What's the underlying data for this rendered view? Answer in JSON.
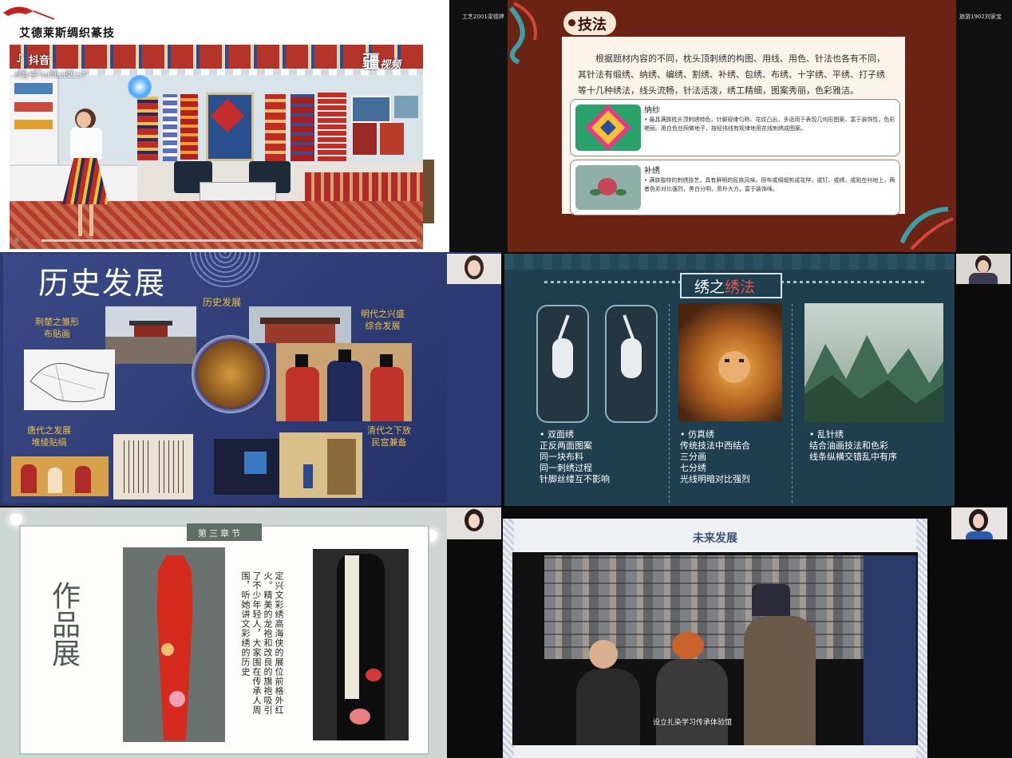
{
  "tile1": {
    "brand": "艾德莱斯绸织篆技",
    "tiktok_name": "抖音",
    "tiktok_id": "抖音号: 4058282257",
    "video_brand": "疆",
    "video_brand2": "视频",
    "participant_name": "工艺2001梁德婷"
  },
  "tile2": {
    "title": "技法",
    "intro": "根据题材内容的不同，枕头顶刺绣的构图、用线、用色、针法也各有不同，其针法有缎绣、纳绣、编绣、割绣、补绣、包绣、布绣、十字绣、平绣、打子绣等十几种绣法，线头流畅，针法活泼，绣工精细，图案秀丽，色彩雅洁。",
    "card1_title": "纳纱",
    "card1_text": "最具满族枕头顶刺绣特色，针脚规律匀称、花纹凸出，多适用于表现几何形图案，富于装饰性，色彩艳丽。用白色丝网做地子，按经纬线有规律地用花线刺绣成图案。",
    "card2_title": "补绣",
    "card2_text": "满族独特的刺绣技艺，具有鲜明的民族风味。用布或绸缎剪成花样，或钉、或绣、或贴在衬地上，两者色彩对比强烈，黑白分明，质朴大方，富于装饰味。",
    "participant_name": "旅游1902刘家宝"
  },
  "tile3": {
    "title": "历史发展",
    "center_label": "历史发展",
    "label_chu": "荆楚之雏形\n布贴画",
    "label_ming": "明代之兴盛\n综合发展",
    "label_tang": "唐代之发展\n堆绫贴绢",
    "label_qing": "清代之下放\n民宫兼备"
  },
  "tile4": {
    "title_a": "绣之",
    "title_b": "绣法",
    "col1": [
      "• 双面绣",
      "正反两面图案",
      "同一块布料",
      "同一刺绣过程",
      "针脚丝缕互不影响"
    ],
    "col2": [
      "• 仿真绣",
      "传统技法中西结合",
      "三分画",
      "七分绣",
      "光线明暗对比强烈"
    ],
    "col3": [
      "• 乱针绣",
      "结合油画技法和色彩",
      "线条纵横交错乱中有序"
    ]
  },
  "tile5": {
    "chapter": "第三章节",
    "title": "作品展",
    "poem": "定兴文彩绣高海侠的展位前格外红火。精美的龙袍和改良的旗袍吸引了不少年轻人，大家围在传承人周围，听她讲文彩绣的历史"
  },
  "tile6": {
    "title": "未来发展",
    "caption": "设立扎染学习传承体验馆"
  },
  "colors": {
    "tile2_bg": "#6b2413",
    "tile3_bg": "#2b3a72",
    "tile4_bg": "#1f3f4f",
    "tile5_bg": "#cdd7d3",
    "accent_red": "#b22020"
  }
}
